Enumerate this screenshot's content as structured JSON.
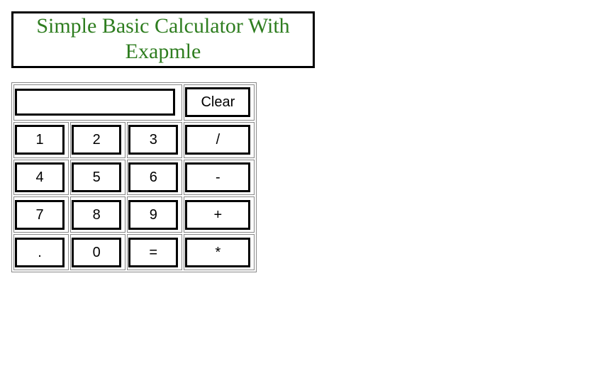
{
  "title": "Simple Basic Calculator With Exapmle",
  "display": {
    "value": "",
    "placeholder": ""
  },
  "clear_label": "Clear",
  "rows": [
    [
      "1",
      "2",
      "3",
      "/"
    ],
    [
      "4",
      "5",
      "6",
      "-"
    ],
    [
      "7",
      "8",
      "9",
      "+"
    ],
    [
      ".",
      "0",
      "=",
      "*"
    ]
  ],
  "colors": {
    "title": "#2e7d1f",
    "border": "#000000",
    "cell_border": "#888888",
    "background": "#ffffff"
  }
}
